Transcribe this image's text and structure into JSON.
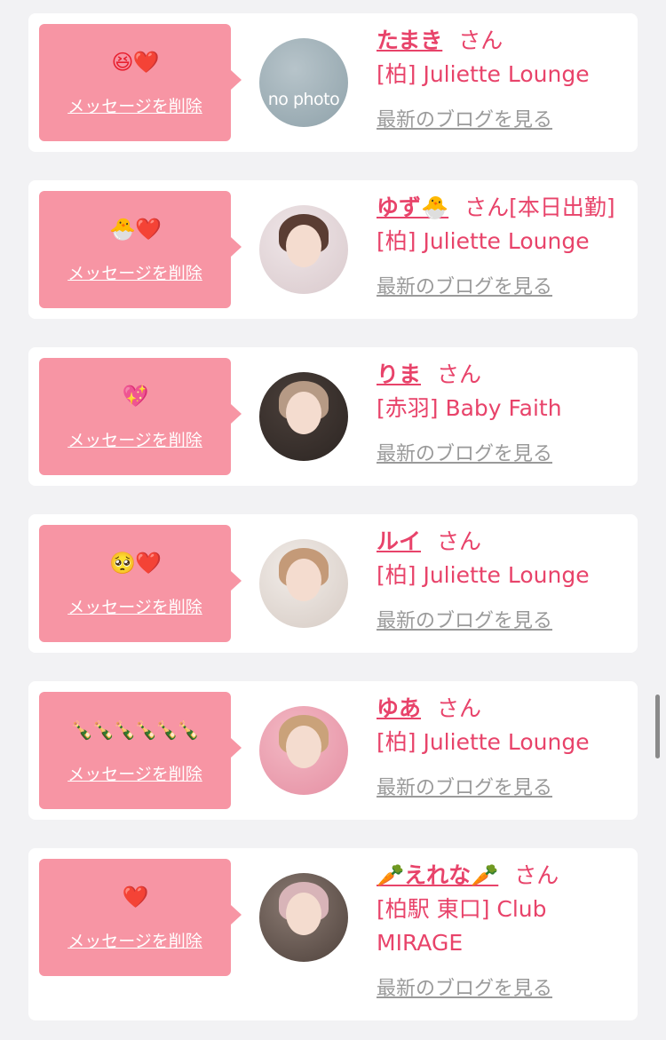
{
  "common": {
    "delete_label": "メッセージを削除",
    "blog_label": "最新のブログを見る",
    "san": "さん"
  },
  "items": [
    {
      "emoji": "😆❤️",
      "name": "たまき",
      "suffix": "さん",
      "shop": "[柏] Juliette Lounge",
      "avatar": {
        "type": "nophoto",
        "text": "no photo",
        "colors": [
          "#b7c4ca",
          "#8fa2aa"
        ]
      }
    },
    {
      "emoji": "🐣❤️",
      "name": "ゆず🐣",
      "suffix": "さん[本日出勤]",
      "shop": "[柏] Juliette Lounge",
      "avatar": {
        "type": "photo",
        "colors": [
          "#efe6e8",
          "#d9c9cc"
        ],
        "hair": "#5a3d33"
      }
    },
    {
      "emoji": "💖",
      "name": "りま",
      "suffix": "さん",
      "shop": "[赤羽] Baby Faith",
      "avatar": {
        "type": "photo",
        "colors": [
          "#4a3f3a",
          "#2c2522"
        ],
        "hair": "#b69a85"
      }
    },
    {
      "emoji": "🥺❤️",
      "name": "ルイ",
      "suffix": "さん",
      "shop": "[柏] Juliette Lounge",
      "avatar": {
        "type": "photo",
        "colors": [
          "#f1ece8",
          "#d6cbc4"
        ],
        "hair": "#c49a78"
      }
    },
    {
      "emoji": "🍾🍾🍾🍾🍾🍾",
      "name": "ゆあ",
      "suffix": "さん",
      "shop": "[柏] Juliette Lounge",
      "avatar": {
        "type": "photo",
        "colors": [
          "#f3b9c4",
          "#e58fa3"
        ],
        "hair": "#caa27a"
      }
    },
    {
      "emoji": "❤️",
      "name": "🥕えれな🥕",
      "suffix": "さん",
      "shop": "[柏駅 東口] Club MIRAGE",
      "avatar": {
        "type": "photo",
        "colors": [
          "#8a7a72",
          "#4e413b"
        ],
        "hair": "#d8b4b8"
      }
    }
  ]
}
